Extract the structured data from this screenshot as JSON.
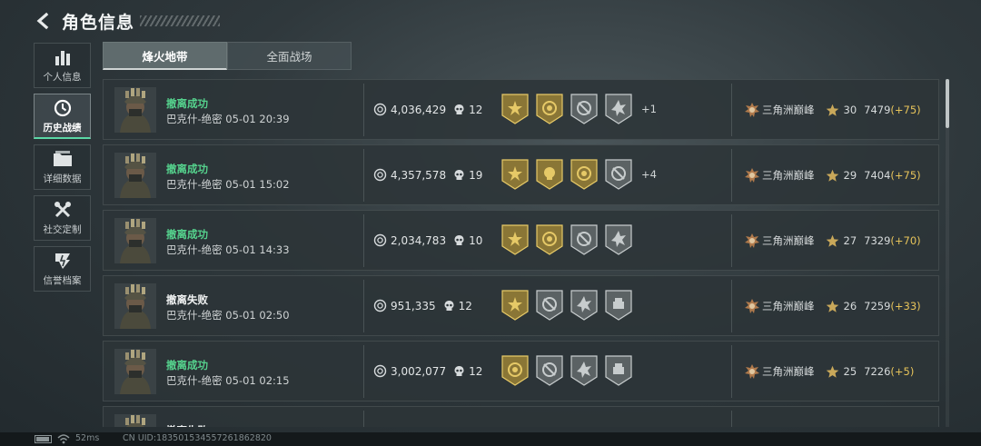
{
  "header": {
    "title": "角色信息"
  },
  "nav": [
    {
      "label": "个人信息",
      "icon": "bar-chart-icon",
      "active": false
    },
    {
      "label": "历史战绩",
      "icon": "history-clock-icon",
      "active": true
    },
    {
      "label": "详细数据",
      "icon": "folder-icon",
      "active": false
    },
    {
      "label": "社交定制",
      "icon": "tools-icon",
      "active": false
    },
    {
      "label": "信誉档案",
      "icon": "credit-shield-icon",
      "active": false
    }
  ],
  "tabs": [
    {
      "label": "烽火地带",
      "active": true
    },
    {
      "label": "全面战场",
      "active": false
    }
  ],
  "colors": {
    "success": "#55d28d",
    "delta": "#e6c35a",
    "active_underline": "#5bd8a6"
  },
  "matches": [
    {
      "result": "撤离成功",
      "status": "success",
      "meta": "巴克什-绝密 05-01 20:39",
      "value": "4,036,429",
      "kills": "12",
      "badges": [
        "gold-star-badge",
        "gold-coin-badge",
        "silver-crosshair-badge",
        "silver-burst-badge"
      ],
      "more": "+1",
      "rank_title": "三角洲巅峰",
      "level": "30",
      "score": "7479",
      "delta": "(+75)"
    },
    {
      "result": "撤离成功",
      "status": "success",
      "meta": "巴克什-绝密 05-01 15:02",
      "value": "4,357,578",
      "kills": "19",
      "badges": [
        "gold-star-badge",
        "gold-skull-badge",
        "gold-coin-badge",
        "silver-crosshair-badge"
      ],
      "more": "+4",
      "rank_title": "三角洲巅峰",
      "level": "29",
      "score": "7404",
      "delta": "(+75)"
    },
    {
      "result": "撤离成功",
      "status": "success",
      "meta": "巴克什-绝密 05-01 14:33",
      "value": "2,034,783",
      "kills": "10",
      "badges": [
        "gold-star-badge",
        "gold-coin-badge",
        "silver-crosshair-badge",
        "silver-burst-badge"
      ],
      "more": "",
      "rank_title": "三角洲巅峰",
      "level": "27",
      "score": "7329",
      "delta": "(+70)"
    },
    {
      "result": "撤离失败",
      "status": "fail",
      "meta": "巴克什-绝密 05-01 02:50",
      "value": "951,335",
      "kills": "12",
      "badges": [
        "gold-star-badge",
        "silver-crosshair-badge",
        "silver-burst-badge",
        "silver-hand-badge"
      ],
      "more": "",
      "rank_title": "三角洲巅峰",
      "level": "26",
      "score": "7259",
      "delta": "(+33)"
    },
    {
      "result": "撤离成功",
      "status": "success",
      "meta": "巴克什-绝密 05-01 02:15",
      "value": "3,002,077",
      "kills": "12",
      "badges": [
        "gold-coin-badge",
        "silver-crosshair-badge",
        "silver-burst-badge",
        "silver-hand-badge"
      ],
      "more": "",
      "rank_title": "三角洲巅峰",
      "level": "25",
      "score": "7226",
      "delta": "(+5)"
    },
    {
      "result": "撤离失败",
      "status": "fail",
      "meta": "",
      "value": "",
      "kills": "",
      "badges": [],
      "more": "",
      "rank_title": "",
      "level": "",
      "score": "",
      "delta": ""
    }
  ],
  "statusbar": {
    "ping": "52ms",
    "uid": "CN UID:1835015345572618628​20"
  }
}
